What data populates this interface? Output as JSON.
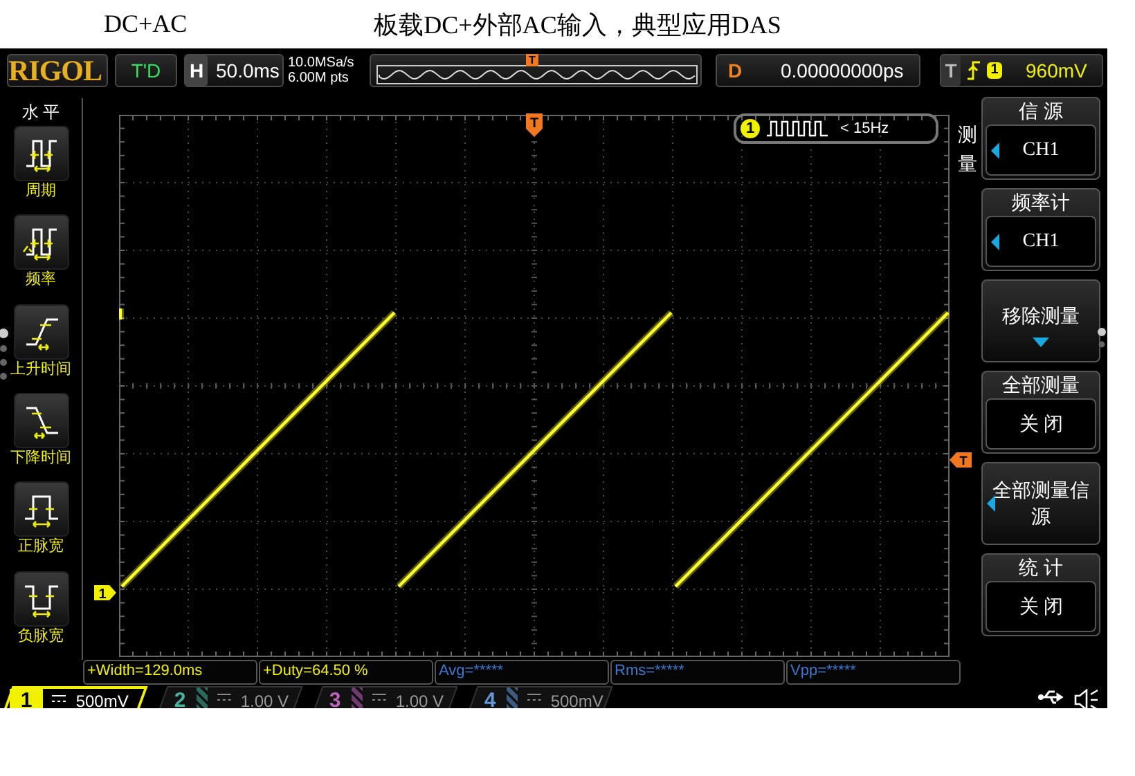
{
  "header": {
    "left_title": "DC+AC",
    "title": "板载DC+外部AC输入，典型应用DAS"
  },
  "top_bar": {
    "logo": "RIGOL",
    "run_state": "T'D",
    "horizontal": {
      "label": "H",
      "value": "50.0ms"
    },
    "sample_rate": "10.0MSa/s",
    "memory_depth": "6.00M pts",
    "overview_marker": "T",
    "delay": {
      "label": "D",
      "value": "0.00000000ps"
    },
    "trigger": {
      "label": "T",
      "source": "1",
      "level": "960mV"
    }
  },
  "left_menu": {
    "title": "水 平",
    "items": [
      {
        "kind": "period",
        "label": "周期"
      },
      {
        "kind": "frequency",
        "label": "频率"
      },
      {
        "kind": "rise",
        "label": "上升时间"
      },
      {
        "kind": "fall",
        "label": "下降时间"
      },
      {
        "kind": "pos_width",
        "label": "正脉宽"
      },
      {
        "kind": "neg_width",
        "label": "负脉宽"
      }
    ]
  },
  "screen": {
    "trigger_position_marker": "T",
    "trigger_level_marker": "T",
    "channel_marker": "1",
    "counter": {
      "channel": "1",
      "value": "< 15Hz"
    }
  },
  "right_menu": {
    "title": "测量",
    "items": [
      {
        "kind": "select",
        "label": "信 源",
        "value": "CH1"
      },
      {
        "kind": "select",
        "label": "频率计",
        "value": "CH1"
      },
      {
        "kind": "action",
        "label": "移除测量"
      },
      {
        "kind": "switch",
        "label": "全部测量",
        "value": "关 闭"
      },
      {
        "kind": "submenu",
        "label": "全部测量信源"
      },
      {
        "kind": "switch",
        "label": "统 计",
        "value": "关 闭"
      }
    ]
  },
  "measurements": [
    {
      "text": "+Width=129.0ms",
      "valid": true
    },
    {
      "text": "+Duty=64.50 %",
      "valid": true
    },
    {
      "text": "Avg=*****",
      "valid": false
    },
    {
      "text": "Rms=*****",
      "valid": false
    },
    {
      "text": "Vpp=*****",
      "valid": false
    }
  ],
  "channels": [
    {
      "number": "1",
      "scale": "500mV",
      "on": true,
      "color": "#f0f000"
    },
    {
      "number": "2",
      "scale": "1.00 V",
      "on": false,
      "color": "#2a6a5e"
    },
    {
      "number": "3",
      "scale": "1.00 V",
      "on": false,
      "color": "#6e3a6e"
    },
    {
      "number": "4",
      "scale": "500mV",
      "on": false,
      "color": "#3a5a80"
    }
  ]
}
